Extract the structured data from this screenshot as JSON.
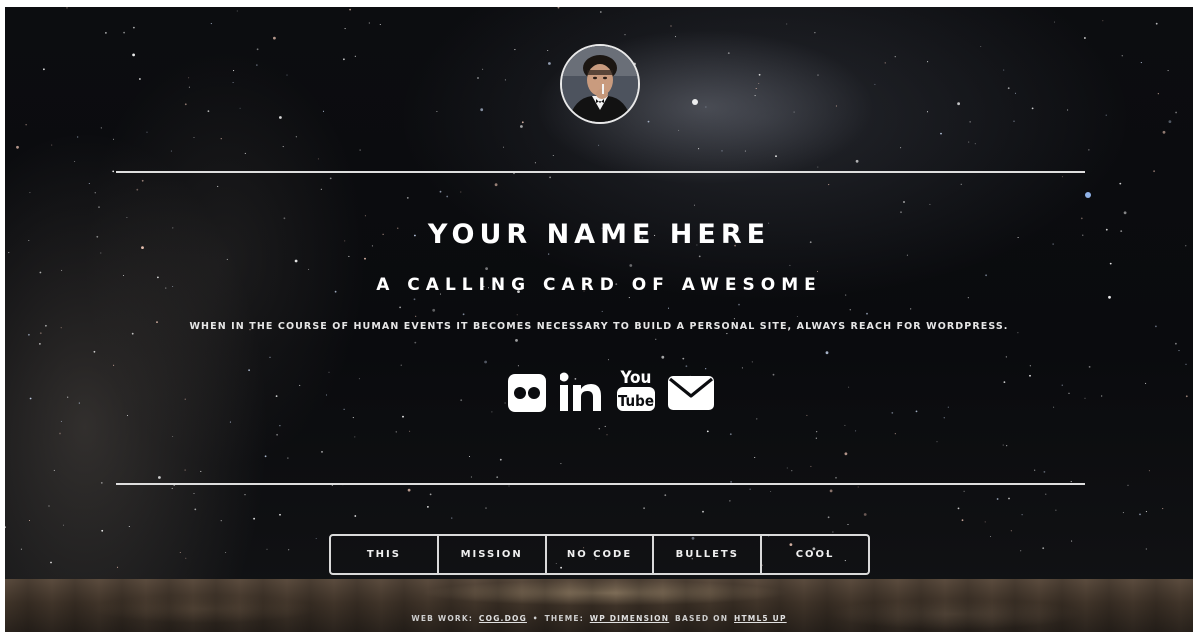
{
  "header": {
    "name": "YOUR NAME HERE",
    "tagline": "A CALLING CARD OF AWESOME",
    "description": "WHEN IN THE COURSE OF HUMAN EVENTS IT BECOMES NECESSARY TO BUILD A PERSONAL SITE, ALWAYS REACH FOR WORDPRESS."
  },
  "social": {
    "icons": [
      "flickr-icon",
      "linkedin-icon",
      "youtube-icon",
      "email-icon"
    ],
    "youtube_text_top": "You",
    "youtube_text_bottom": "Tube"
  },
  "nav": {
    "items": [
      "THIS",
      "MISSION",
      "NO CODE",
      "BULLETS",
      "COOL"
    ]
  },
  "footer": {
    "web_work_label": "WEB WORK:",
    "web_work_link": "COG.DOG",
    "separator": "•",
    "theme_label": "THEME:",
    "theme_link": "WP DIMENSION",
    "based_on_label": "BASED ON",
    "based_on_link": "HTML5 UP"
  },
  "colors": {
    "background": "#0a0b0e",
    "text": "#ffffff",
    "rule": "#dedede"
  }
}
